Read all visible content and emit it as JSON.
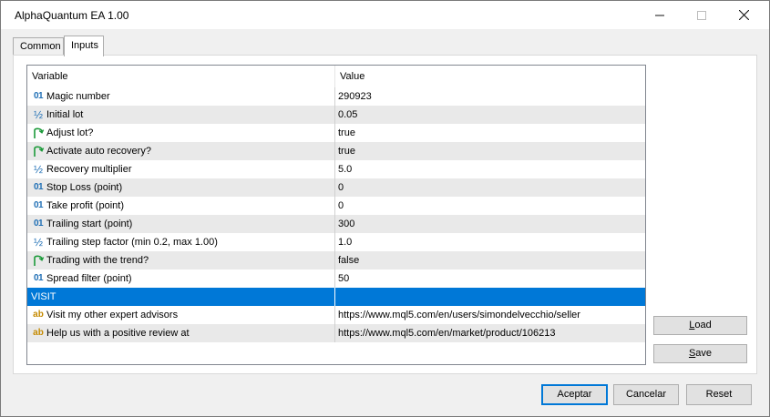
{
  "window": {
    "title": "AlphaQuantum EA 1.00"
  },
  "tabs": [
    {
      "label": "Common",
      "active": false
    },
    {
      "label": "Inputs",
      "active": true
    }
  ],
  "grid": {
    "header_variable": "Variable",
    "header_value": "Value",
    "rows": [
      {
        "icon": "int-icon",
        "icon_text": "01",
        "variable": "Magic number",
        "value": "290923"
      },
      {
        "icon": "double-icon",
        "icon_text": "½",
        "variable": "Initial lot",
        "value": "0.05"
      },
      {
        "icon": "bool-icon",
        "icon_text": "",
        "variable": "Adjust lot?",
        "value": "true"
      },
      {
        "icon": "bool-icon",
        "icon_text": "",
        "variable": "Activate auto recovery?",
        "value": "true"
      },
      {
        "icon": "double-icon",
        "icon_text": "½",
        "variable": "Recovery multiplier",
        "value": "5.0"
      },
      {
        "icon": "int-icon",
        "icon_text": "01",
        "variable": "Stop Loss (point)",
        "value": "0"
      },
      {
        "icon": "int-icon",
        "icon_text": "01",
        "variable": "Take profit (point)",
        "value": "0"
      },
      {
        "icon": "int-icon",
        "icon_text": "01",
        "variable": "Trailing start (point)",
        "value": "300"
      },
      {
        "icon": "double-icon",
        "icon_text": "½",
        "variable": "Trailing step factor (min 0.2, max 1.00)",
        "value": "1.0"
      },
      {
        "icon": "bool-icon",
        "icon_text": "",
        "variable": "Trading with the trend?",
        "value": "false"
      },
      {
        "icon": "int-icon",
        "icon_text": "01",
        "variable": "Spread filter (point)",
        "value": "50"
      },
      {
        "icon": "",
        "icon_text": "",
        "variable": "VISIT",
        "value": "",
        "selected": true
      },
      {
        "icon": "string-icon",
        "icon_text": "ab",
        "variable": "Visit my other expert advisors",
        "value": "https://www.mql5.com/en/users/simondelvecchio/seller"
      },
      {
        "icon": "string-icon",
        "icon_text": "ab",
        "variable": "Help us with a positive review at",
        "value": "https://www.mql5.com/en/market/product/106213"
      }
    ]
  },
  "side_buttons": {
    "load": {
      "label_u": "L",
      "label_rest": "oad"
    },
    "save": {
      "label_u": "S",
      "label_rest": "ave"
    }
  },
  "bottom_buttons": {
    "ok": "Aceptar",
    "cancel": "Cancelar",
    "reset": "Reset"
  },
  "colors": {
    "selection": "#0078d7",
    "alt_row": "#e9e9e9",
    "int_icon": "#1f6fb5",
    "bool_icon": "#1c9a3a",
    "string_icon": "#c58a00"
  }
}
